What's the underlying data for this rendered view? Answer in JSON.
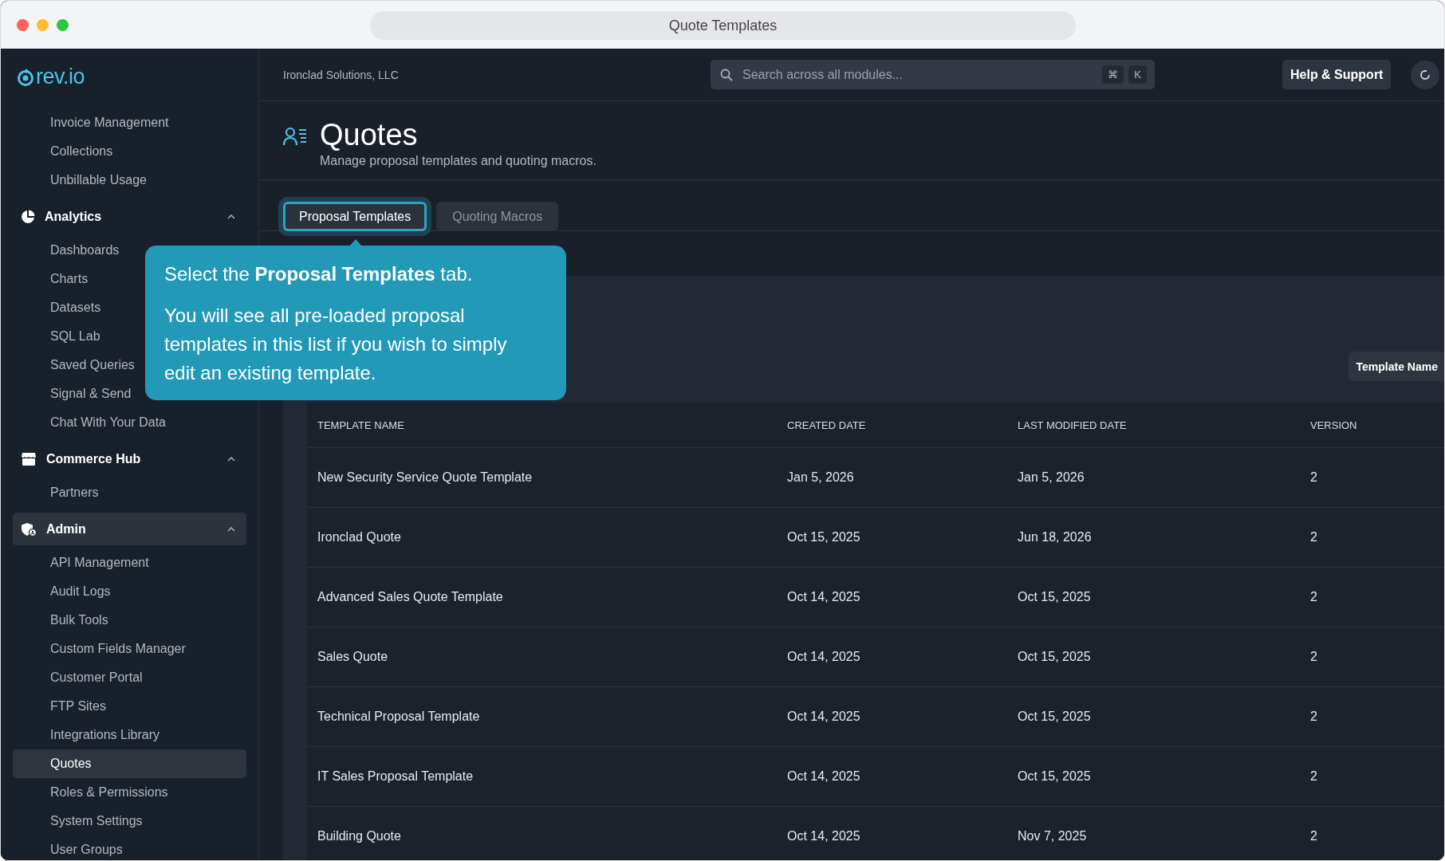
{
  "window": {
    "title": "Quote Templates"
  },
  "sidebar": {
    "logo": "rev.io",
    "sections": [
      {
        "items": [
          {
            "label": "Invoice Management",
            "selected": false
          },
          {
            "label": "Collections",
            "selected": false
          },
          {
            "label": "Unbillable Usage",
            "selected": false
          }
        ]
      },
      {
        "title": "Analytics",
        "expanded": true,
        "selected": false,
        "items": [
          {
            "label": "Dashboards",
            "selected": false
          },
          {
            "label": "Charts",
            "selected": false
          },
          {
            "label": "Datasets",
            "selected": false
          },
          {
            "label": "SQL Lab",
            "selected": false
          },
          {
            "label": "Saved Queries",
            "selected": false
          },
          {
            "label": "Signal & Send",
            "selected": false
          },
          {
            "label": "Chat With Your Data",
            "selected": false
          }
        ]
      },
      {
        "title": "Commerce Hub",
        "expanded": true,
        "selected": false,
        "items": [
          {
            "label": "Partners",
            "selected": false
          }
        ]
      },
      {
        "title": "Admin",
        "expanded": true,
        "selected": true,
        "items": [
          {
            "label": "API Management",
            "selected": false
          },
          {
            "label": "Audit Logs",
            "selected": false
          },
          {
            "label": "Bulk Tools",
            "selected": false
          },
          {
            "label": "Custom Fields Manager",
            "selected": false
          },
          {
            "label": "Customer Portal",
            "selected": false
          },
          {
            "label": "FTP Sites",
            "selected": false
          },
          {
            "label": "Integrations Library",
            "selected": false
          },
          {
            "label": "Quotes",
            "selected": true
          },
          {
            "label": "Roles & Permissions",
            "selected": false
          },
          {
            "label": "System Settings",
            "selected": false
          },
          {
            "label": "User Groups",
            "selected": false
          }
        ]
      }
    ]
  },
  "topbar": {
    "company": "Ironclad Solutions, LLC",
    "search": {
      "placeholder": "Search across all modules...",
      "keys": [
        "⌘",
        "K"
      ]
    },
    "help_button": "Help & Support"
  },
  "header": {
    "title": "Quotes",
    "subtitle": "Manage proposal templates and quoting macros."
  },
  "tabs": [
    {
      "label": "Proposal Templates",
      "selected": true
    },
    {
      "label": "Quoting Macros",
      "selected": false
    }
  ],
  "tooltip": {
    "paragraphs": [
      "Select the **Proposal Templates** tab.",
      "You will see all pre-loaded proposal templates in this list if you wish to simply edit an existing template."
    ]
  },
  "sort": {
    "label": "Template Name"
  },
  "table": {
    "columns": [
      "TEMPLATE NAME",
      "CREATED DATE",
      "LAST MODIFIED DATE",
      "VERSION"
    ],
    "rows": [
      [
        "New Security Service Quote Template",
        "Jan 5, 2026",
        "Jan 5, 2026",
        "2"
      ],
      [
        "Ironclad Quote",
        "Oct 15, 2025",
        "Jun 18, 2026",
        "2"
      ],
      [
        "Advanced Sales Quote Template",
        "Oct 14, 2025",
        "Oct 15, 2025",
        "2"
      ],
      [
        "Sales Quote",
        "Oct 14, 2025",
        "Oct 15, 2025",
        "2"
      ],
      [
        "Technical Proposal Template",
        "Oct 14, 2025",
        "Oct 15, 2025",
        "2"
      ],
      [
        "IT Sales Proposal Template",
        "Oct 14, 2025",
        "Oct 15, 2025",
        "2"
      ],
      [
        "Building Quote",
        "Oct 14, 2025",
        "Nov 7, 2025",
        "2"
      ]
    ]
  }
}
